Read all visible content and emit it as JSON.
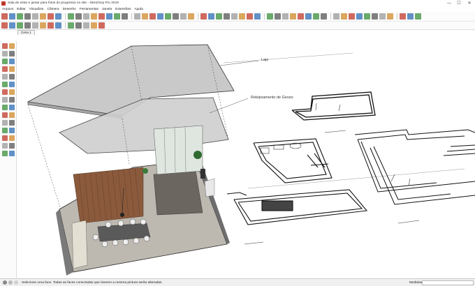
{
  "window": {
    "title": "Sala de estar e jantar para fotos do progresso no site - SketchUp Pro 2019",
    "controls": {
      "minimize": "—",
      "maximize": "☐",
      "close": "✕"
    }
  },
  "menu": [
    "Arquivo",
    "Editar",
    "Visualizar",
    "Câmera",
    "Desenho",
    "Ferramentas",
    "Janela",
    "Extensões",
    "Ajuda"
  ],
  "scene_tabs": [
    "Cena 1"
  ],
  "annotations": {
    "laje": "Laje",
    "rebaixamento": "Rebaixamento de Gesso"
  },
  "status": {
    "message": "Selecione uma face. Todas as faces conectadas que tiverem a mesma pintura serão alteradas.",
    "measure_label": "Medidas",
    "measure_value": ""
  },
  "colors": {
    "slab": "#c9c9c9",
    "wall": "#8a8a8a",
    "floor": "#bdb8b0",
    "rug": "#6b6660",
    "wood": "#8b5a3c",
    "toolbar_red": "#c0392b",
    "toolbar_blue": "#2e6db4",
    "toolbar_green": "#3a8f3a"
  },
  "icons": {
    "toolbar1": [
      "pointer-icon",
      "eraser-icon",
      "line-icon",
      "freehand-icon",
      "rectangle-icon",
      "rotated-rectangle-icon",
      "circle-icon",
      "polygon-icon",
      "arc-icon",
      "pie-icon",
      "push-pull-icon",
      "follow-me-icon",
      "offset-icon",
      "move-icon",
      "rotate-icon",
      "scale-icon",
      "tape-icon",
      "dimension-icon",
      "protractor-icon",
      "text-icon",
      "axes-icon",
      "3d-text-icon",
      "paint-icon",
      "orbit-icon",
      "pan-icon",
      "zoom-icon",
      "zoom-extents-icon",
      "warehouse-icon",
      "extension-warehouse-icon",
      "layout-icon",
      "style-icon",
      "section-icon",
      "model-info-icon",
      "solid-icon",
      "union-icon",
      "subtract-icon",
      "trim-icon",
      "split-icon",
      "sandbox-icon",
      "smoove-icon",
      "stamp-icon",
      "drape-icon",
      "add-detail-icon",
      "flip-edge-icon",
      "geo-icon",
      "photo-icon",
      "camera-icon",
      "walk-icon",
      "look-icon",
      "position-camera-icon",
      "advanced-camera-icon"
    ],
    "toolbar2": [
      "iso-icon",
      "top-icon",
      "front-icon",
      "right-icon",
      "back-icon",
      "left-icon",
      "xray-icon",
      "back-edges-icon",
      "wireframe-icon",
      "hidden-line-icon",
      "shaded-icon",
      "shaded-texture-icon",
      "monochrome-icon"
    ]
  }
}
